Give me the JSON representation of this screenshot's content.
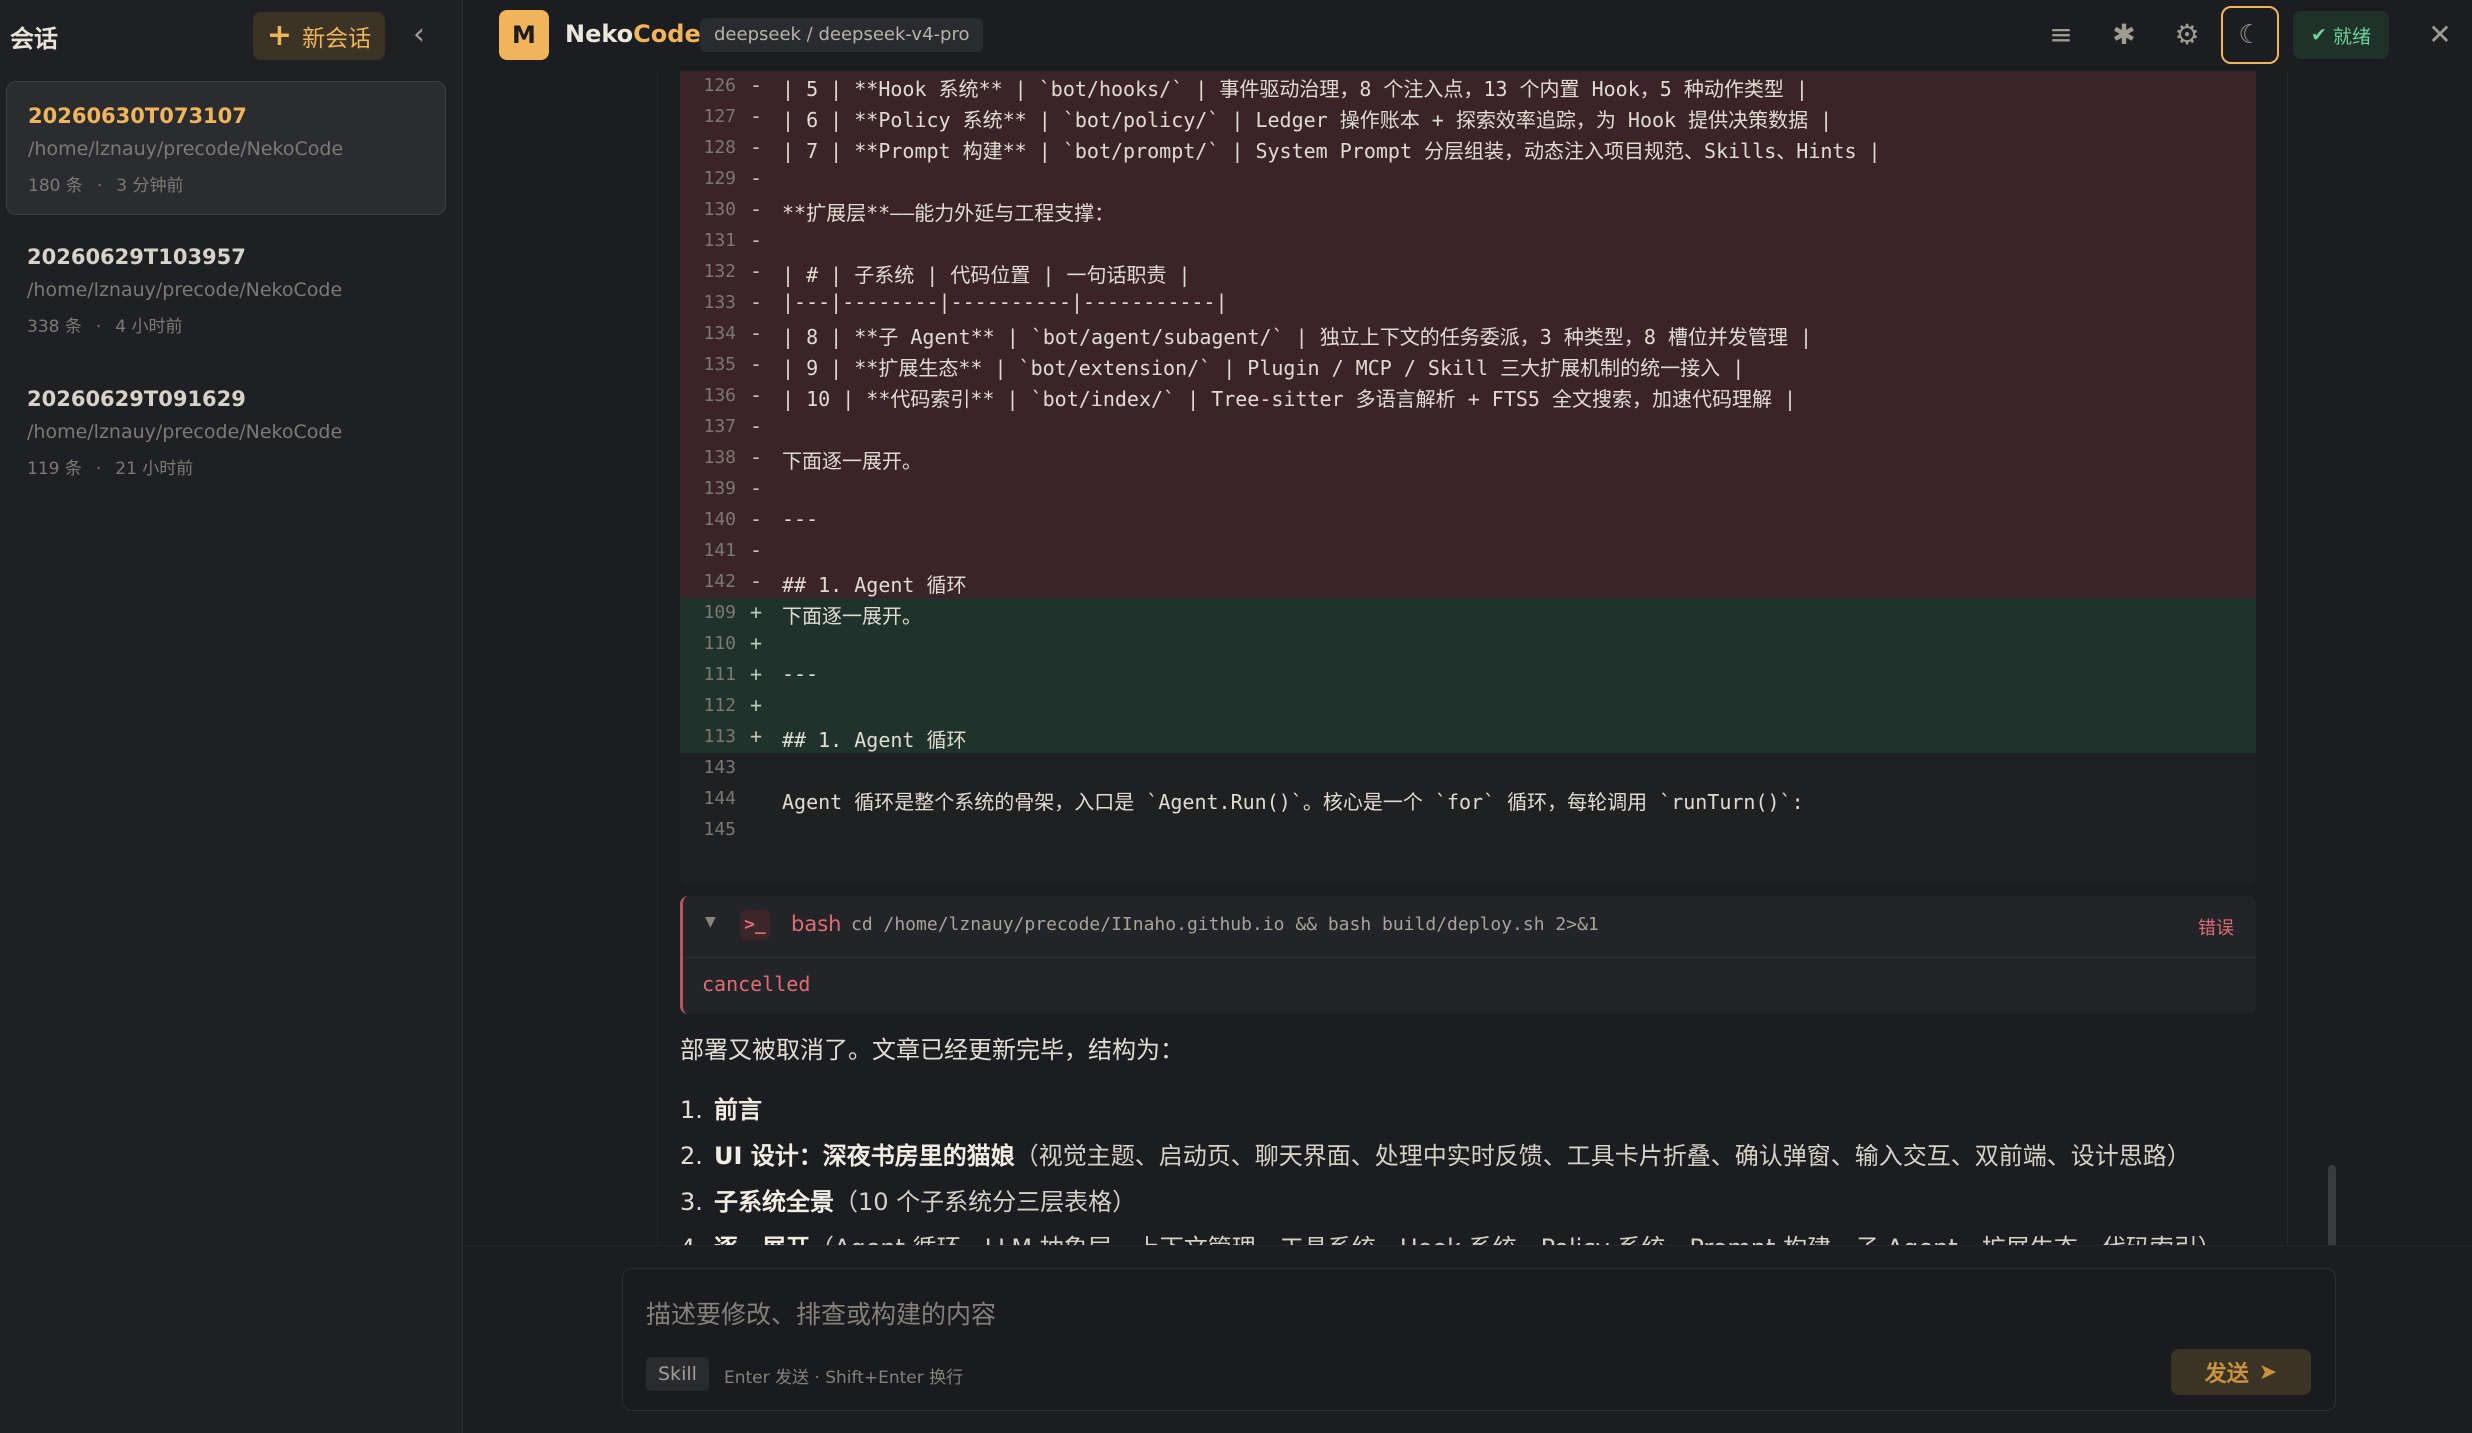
{
  "sidebar": {
    "title": "会话",
    "new_button": "新会话",
    "sessions": [
      {
        "name": "20260630T073107",
        "path": "/home/lznauy/precode/NekoCode",
        "count": "180 条",
        "time": "3 分钟前",
        "active": true
      },
      {
        "name": "20260629T103957",
        "path": "/home/lznauy/precode/NekoCode",
        "count": "338 条",
        "time": "4 小时前",
        "active": false
      },
      {
        "name": "20260629T091629",
        "path": "/home/lznauy/precode/NekoCode",
        "count": "119 条",
        "time": "21 小时前",
        "active": false
      }
    ]
  },
  "topbar": {
    "logo_letter": "M",
    "brand_part1": "Neko",
    "brand_part2": "Code",
    "model": "deepseek / deepseek-v4-pro",
    "status": "就绪"
  },
  "diff": [
    {
      "num": "126",
      "sign": "-",
      "type": "del",
      "text": "| 5 | **Hook 系统** | `bot/hooks/` | 事件驱动治理，8 个注入点，13 个内置 Hook，5 种动作类型 |"
    },
    {
      "num": "127",
      "sign": "-",
      "type": "del",
      "text": "| 6 | **Policy 系统** | `bot/policy/` | Ledger 操作账本 + 探索效率追踪，为 Hook 提供决策数据 |"
    },
    {
      "num": "128",
      "sign": "-",
      "type": "del",
      "text": "| 7 | **Prompt 构建** | `bot/prompt/` | System Prompt 分层组装，动态注入项目规范、Skills、Hints |"
    },
    {
      "num": "129",
      "sign": "-",
      "type": "del",
      "text": ""
    },
    {
      "num": "130",
      "sign": "-",
      "type": "del",
      "text": "**扩展层**——能力外延与工程支撑："
    },
    {
      "num": "131",
      "sign": "-",
      "type": "del",
      "text": ""
    },
    {
      "num": "132",
      "sign": "-",
      "type": "del",
      "text": "| # | 子系统 | 代码位置 | 一句话职责 |"
    },
    {
      "num": "133",
      "sign": "-",
      "type": "del",
      "text": "|---|--------|----------|-----------|"
    },
    {
      "num": "134",
      "sign": "-",
      "type": "del",
      "text": "| 8 | **子 Agent** | `bot/agent/subagent/` | 独立上下文的任务委派，3 种类型，8 槽位并发管理 |"
    },
    {
      "num": "135",
      "sign": "-",
      "type": "del",
      "text": "| 9 | **扩展生态** | `bot/extension/` | Plugin / MCP / Skill 三大扩展机制的统一接入 |"
    },
    {
      "num": "136",
      "sign": "-",
      "type": "del",
      "text": "| 10 | **代码索引** | `bot/index/` | Tree-sitter 多语言解析 + FTS5 全文搜索，加速代码理解 |"
    },
    {
      "num": "137",
      "sign": "-",
      "type": "del",
      "text": ""
    },
    {
      "num": "138",
      "sign": "-",
      "type": "del",
      "text": "下面逐一展开。"
    },
    {
      "num": "139",
      "sign": "-",
      "type": "del",
      "text": ""
    },
    {
      "num": "140",
      "sign": "-",
      "type": "del",
      "text": "---"
    },
    {
      "num": "141",
      "sign": "-",
      "type": "del",
      "text": ""
    },
    {
      "num": "142",
      "sign": "-",
      "type": "del",
      "text": "## 1. Agent 循环"
    },
    {
      "num": "109",
      "sign": "+",
      "type": "add",
      "text": "下面逐一展开。"
    },
    {
      "num": "110",
      "sign": "+",
      "type": "add",
      "text": ""
    },
    {
      "num": "111",
      "sign": "+",
      "type": "add",
      "text": "---"
    },
    {
      "num": "112",
      "sign": "+",
      "type": "add",
      "text": ""
    },
    {
      "num": "113",
      "sign": "+",
      "type": "add",
      "text": "## 1. Agent 循环"
    },
    {
      "num": "143",
      "sign": "",
      "type": "ctx",
      "text": ""
    },
    {
      "num": "144",
      "sign": "",
      "type": "ctx",
      "text": "Agent 循环是整个系统的骨架，入口是 `Agent.Run()`。核心是一个 `for` 循环，每轮调用 `runTurn()`:"
    },
    {
      "num": "145",
      "sign": "",
      "type": "ctx",
      "text": ""
    }
  ],
  "tool": {
    "name": "bash",
    "command": "cd /home/lznauy/precode/IInaho.github.io && bash build/deploy.sh 2>&1",
    "status": "错误",
    "output": "cancelled"
  },
  "answer": {
    "intro": "部署又被取消了。文章已经更新完毕，结构为：",
    "items": [
      {
        "n": "1.",
        "bold": "前言",
        "rest": ""
      },
      {
        "n": "2.",
        "bold": "UI 设计：深夜书房里的猫娘",
        "rest": "（视觉主题、启动页、聊天界面、处理中实时反馈、工具卡片折叠、确认弹窗、输入交互、双前端、设计思路）"
      },
      {
        "n": "3.",
        "bold": "子系统全景",
        "rest": "（10 个子系统分三层表格）"
      },
      {
        "n": "4.",
        "bold": "逐一展开",
        "rest": "（Agent 循环、LLM 抽象层、上下文管理、工具系统、Hook 系统、Policy 系统、Prompt 构建、子 Agent、扩展生态、代码索引）"
      }
    ]
  },
  "composer": {
    "placeholder": "描述要修改、排查或构建的内容",
    "skill": "Skill",
    "hint": "Enter 发送 · Shift+Enter 换行",
    "send": "发送"
  },
  "colors": {
    "accent": "#f0b45a",
    "del_bg": "#3a2427",
    "add_bg": "#1f332c",
    "error": "#e06c75",
    "ok": "#6fcf97"
  }
}
